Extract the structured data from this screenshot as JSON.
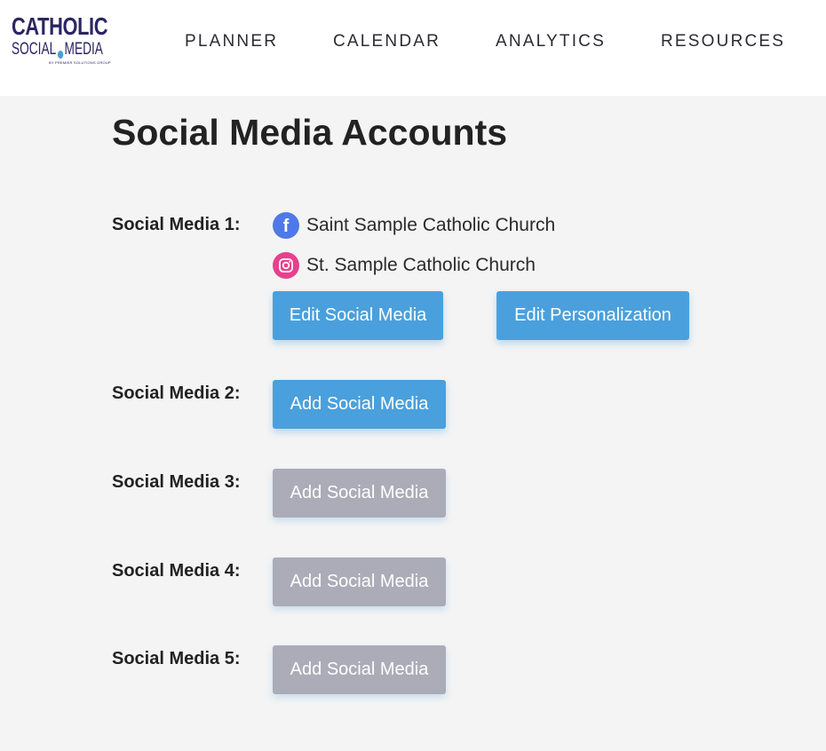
{
  "logo": {
    "line1": "CATHOLIC",
    "line2a": "SOCIAL",
    "line2b": "MEDIA",
    "sub": "BY PREMIER SOLUTIONS GROUP"
  },
  "nav": {
    "planner": "PLANNER",
    "calendar": "CALENDAR",
    "analytics": "ANALYTICS",
    "resources": "RESOURCES"
  },
  "page": {
    "title": "Social Media Accounts"
  },
  "accounts": [
    {
      "label": "Social Media 1:",
      "connected": [
        {
          "network": "facebook",
          "icon": "facebook-icon",
          "name": "Saint Sample Catholic Church"
        },
        {
          "network": "instagram",
          "icon": "instagram-icon",
          "name": "St. Sample Catholic Church"
        }
      ],
      "edit_label": "Edit Social Media",
      "personalize_label": "Edit Personalization"
    },
    {
      "label": "Social Media 2:",
      "button": "Add Social Media",
      "enabled": true
    },
    {
      "label": "Social Media 3:",
      "button": "Add Social Media",
      "enabled": false
    },
    {
      "label": "Social Media 4:",
      "button": "Add Social Media",
      "enabled": false
    },
    {
      "label": "Social Media 5:",
      "button": "Add Social Media",
      "enabled": false
    }
  ],
  "colors": {
    "brand": "#2a2563",
    "button_active": "#4aa0dc",
    "button_disabled": "#abacb8",
    "facebook": "#4f79e8",
    "instagram": "#e8408e",
    "background": "#f4f4f4"
  }
}
